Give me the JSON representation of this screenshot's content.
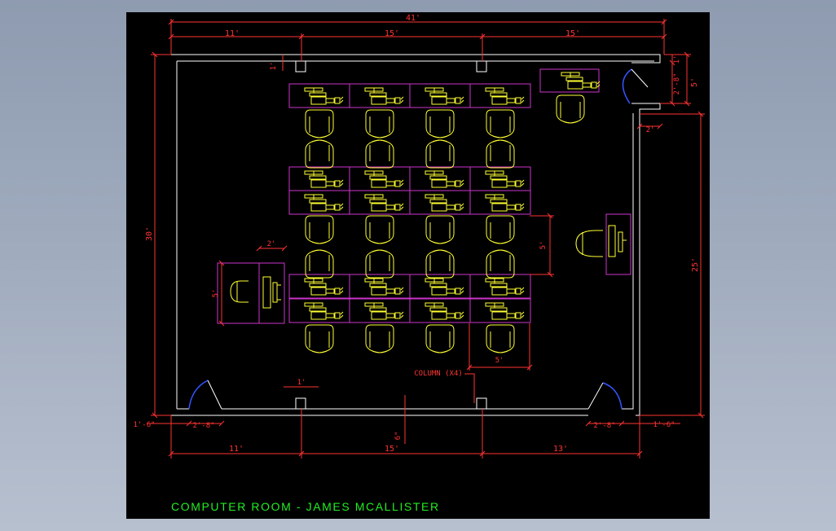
{
  "title": "COMPUTER ROOM - JAMES MCALLISTER",
  "colors": {
    "background": "#000000",
    "wall": "#ffffff",
    "dimension": "#ff3333",
    "desk": "#cc33cc",
    "furniture": "#ffff33",
    "title": "#22ee22",
    "door": "#3355ff"
  },
  "dimensions": {
    "overall_width": "41'",
    "top_left": "11'",
    "top_mid": "15'",
    "top_right": "15'",
    "left_height": "30'",
    "right_height": "25'",
    "right_upper_total": "5'",
    "right_upper_1": "1'",
    "right_upper_2": "2'-8\"",
    "right_step": "2'",
    "column_size": "1'",
    "column_size_bottom": "1'",
    "teacher_desk_width": "2'",
    "teacher_desk_depth": "5'",
    "row_gap": "5'",
    "desk_width": "5'",
    "bottom_left": "11'",
    "bottom_mid": "15'",
    "bottom_right": "13'",
    "bottom_left_door_offset": "1'-6\"",
    "bottom_left_door": "2'-8\"",
    "bottom_right_door": "2'-8\"",
    "bottom_right_door_offset": "1'-6\"",
    "wall_thickness": "6\""
  },
  "annotations": {
    "column_label": "COLUMN (X4)"
  }
}
